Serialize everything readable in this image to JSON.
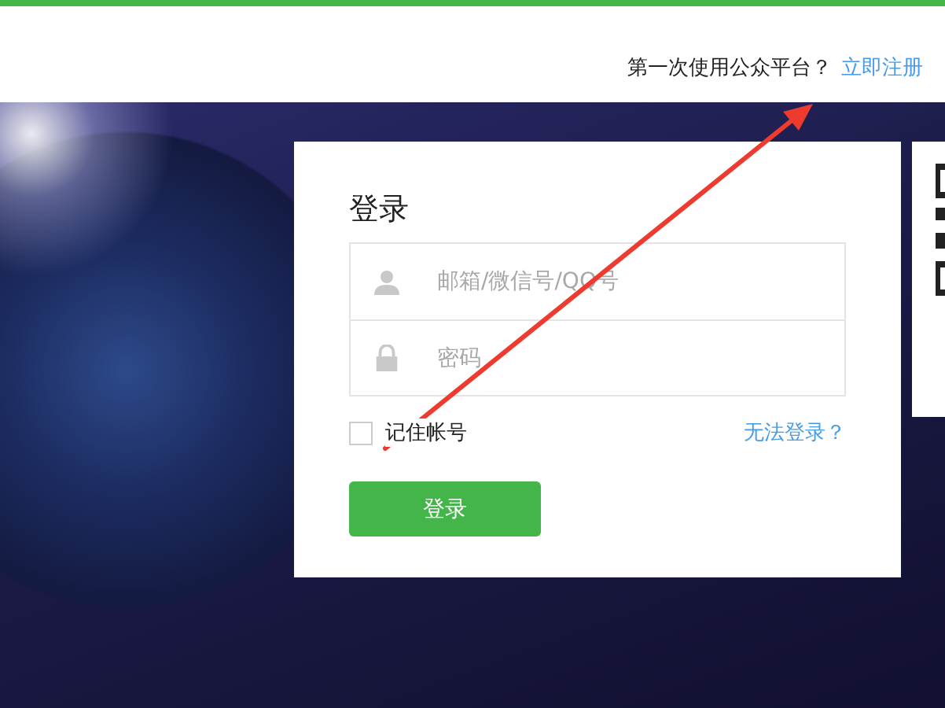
{
  "header": {
    "prompt": "第一次使用公众平台？",
    "register_link": "立即注册"
  },
  "login": {
    "title": "登录",
    "fields": [
      {
        "kind": "account",
        "placeholder": "邮箱/微信号/QQ号"
      },
      {
        "kind": "password",
        "placeholder": "密码"
      }
    ],
    "remember": {
      "label": "记住帐号",
      "checked": false
    },
    "help_link": "无法登录？",
    "submit": "登录"
  }
}
